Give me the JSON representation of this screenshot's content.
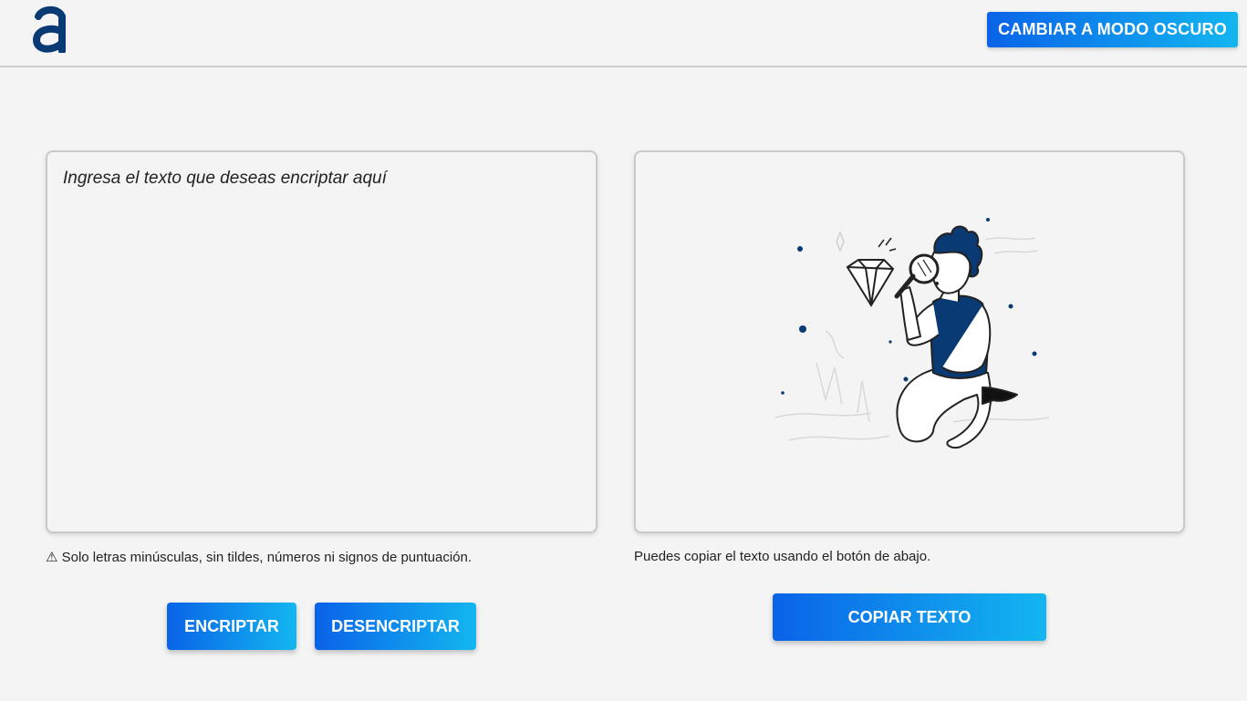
{
  "header": {
    "logo_icon": "alura-a-logo-icon",
    "theme_button_label": "CAMBIAR A MODO OSCURO"
  },
  "input": {
    "placeholder": "Ingresa el texto que deseas encriptar aquí",
    "value": ""
  },
  "hints": {
    "warning_icon": "⚠",
    "warning_text": " Solo letras minúsculas, sin tildes, números ni signos de puntuación.",
    "copy_hint": "Puedes copiar el texto usando el botón de abajo."
  },
  "buttons": {
    "encrypt": "ENCRIPTAR",
    "decrypt": "DESENCRIPTAR",
    "copy": "COPIAR TEXTO"
  },
  "output": {
    "illustration_icon": "person-with-magnifier-illustration-icon"
  },
  "colors": {
    "accent_start": "#0a63e8",
    "accent_end": "#13b6f0",
    "logo": "#0a3a73",
    "background": "#f4f4f4"
  }
}
